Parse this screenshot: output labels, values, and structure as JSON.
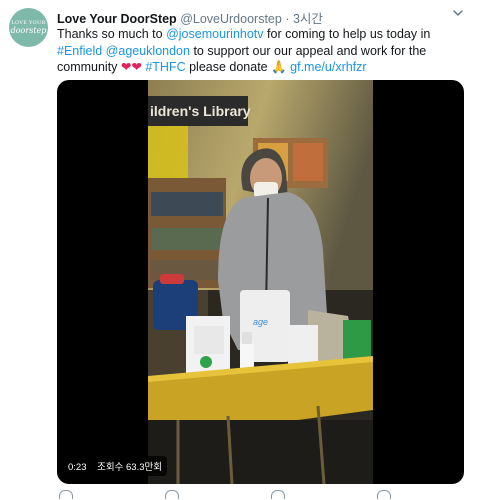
{
  "account": {
    "avatar_text_top": "LOVE YOUR",
    "avatar_text_bottom": "doorstep",
    "name": "Love Your DoorStep",
    "handle": "@LoveUrdoorstep",
    "separator": "·",
    "time": "3시간"
  },
  "tweet": {
    "t1": "Thanks so much to ",
    "mention_jose": "@josemourinhotv",
    "t2": " for coming to help us today in ",
    "hashtag_enfield": "#Enfield",
    "t3": " ",
    "mention_ageuk": "@ageuklondon",
    "t4": " to support our our appeal and work for the community ",
    "hearts": "❤❤",
    "t5": " ",
    "hashtag_thfc": "#THFC",
    "t6": "  please donate 🙏 ",
    "link": "gf.me/u/xrhfzr"
  },
  "video": {
    "duration": "0:23",
    "views": "조회수 63.3만회",
    "sign_text": "ildren's Library",
    "bag_text": "age"
  },
  "colors": {
    "accent": "#1b95e0",
    "heart": "#e0245e",
    "avatar": "#7fb9a9"
  },
  "icons": {
    "menu": "chevron-down-icon",
    "actions": [
      "reply-icon",
      "retweet-icon",
      "like-icon",
      "share-icon"
    ]
  }
}
